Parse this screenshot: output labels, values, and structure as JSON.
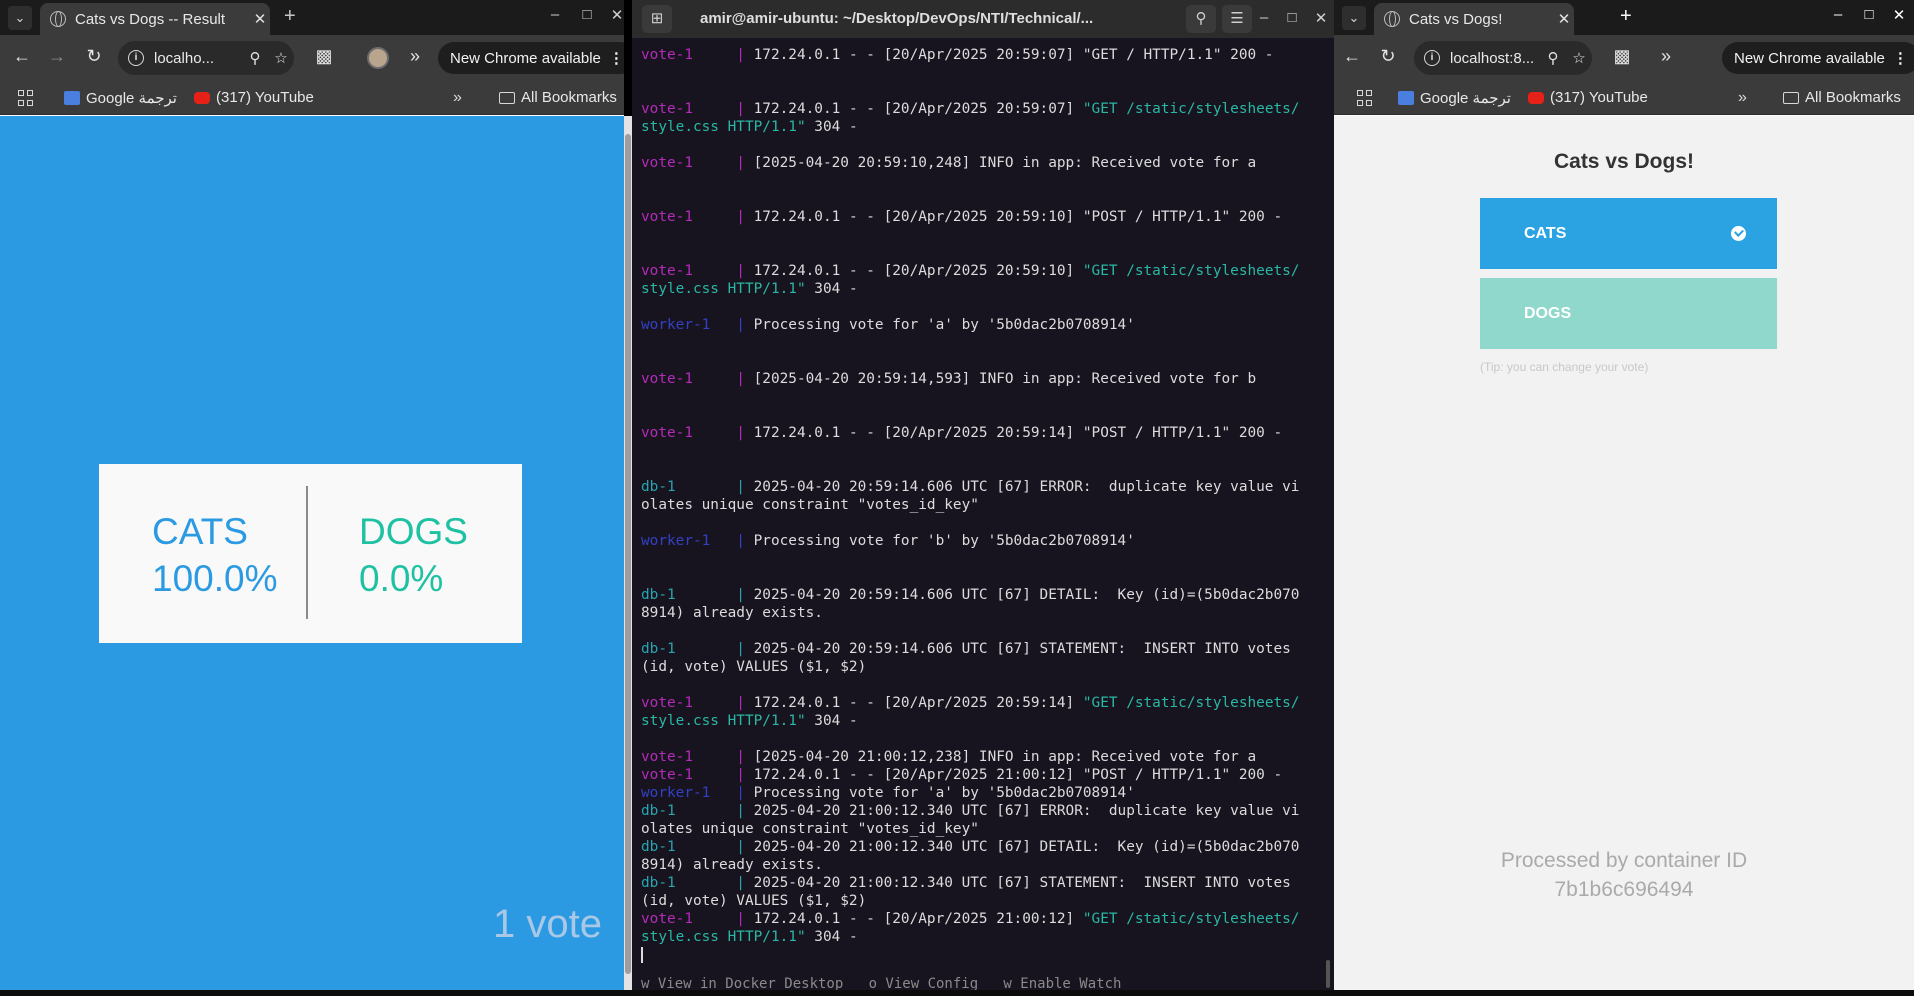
{
  "left_window": {
    "tab_title": "Cats vs Dogs -- Result",
    "url": "localho...",
    "new_chrome": "New Chrome available",
    "bookmarks": [
      "Google ترجمة",
      "(317) YouTube"
    ],
    "all_bookmarks": "All Bookmarks"
  },
  "result": {
    "cats_label": "CATS",
    "cats_pct": "100.0%",
    "dogs_label": "DOGS",
    "dogs_pct": "0.0%",
    "votes": "1 vote",
    "colors": {
      "background": "#2b9ae3",
      "cats": "#2b9ae3",
      "dogs": "#1ec1a2"
    }
  },
  "terminal": {
    "title": "amir@amir-ubuntu: ~/Desktop/DevOps/NTI/Technical/...",
    "lines": [
      {
        "svc": "vote-1",
        "type": "vote",
        "text": "172.24.0.1 - - [20/Apr/2025 20:59:07] \"GET / HTTP/1.1\" 200 -"
      },
      {
        "svc": "",
        "type": "",
        "text": ""
      },
      {
        "svc": "",
        "type": "",
        "text": ""
      },
      {
        "svc": "vote-1",
        "type": "vote",
        "text": "172.24.0.1 - - [20/Apr/2025 20:59:07] ",
        "path": "\"GET /static/stylesheets/"
      },
      {
        "svc": "",
        "type": "",
        "text": "",
        "path": "style.css HTTP/1.1\"",
        "tail": " 304 -"
      },
      {
        "svc": "",
        "type": "",
        "text": ""
      },
      {
        "svc": "vote-1",
        "type": "vote",
        "text": "[2025-04-20 20:59:10,248] INFO in app: Received vote for a"
      },
      {
        "svc": "",
        "type": "",
        "text": ""
      },
      {
        "svc": "",
        "type": "",
        "text": ""
      },
      {
        "svc": "vote-1",
        "type": "vote",
        "text": "172.24.0.1 - - [20/Apr/2025 20:59:10] \"POST / HTTP/1.1\" 200 -"
      },
      {
        "svc": "",
        "type": "",
        "text": ""
      },
      {
        "svc": "",
        "type": "",
        "text": ""
      },
      {
        "svc": "vote-1",
        "type": "vote",
        "text": "172.24.0.1 - - [20/Apr/2025 20:59:10] ",
        "path": "\"GET /static/stylesheets/"
      },
      {
        "svc": "",
        "type": "",
        "text": "",
        "path": "style.css HTTP/1.1\"",
        "tail": " 304 -"
      },
      {
        "svc": "",
        "type": "",
        "text": ""
      },
      {
        "svc": "worker-1",
        "type": "worker",
        "text": "Processing vote for 'a' by '5b0dac2b0708914'"
      },
      {
        "svc": "",
        "type": "",
        "text": ""
      },
      {
        "svc": "",
        "type": "",
        "text": ""
      },
      {
        "svc": "vote-1",
        "type": "vote",
        "text": "[2025-04-20 20:59:14,593] INFO in app: Received vote for b"
      },
      {
        "svc": "",
        "type": "",
        "text": ""
      },
      {
        "svc": "",
        "type": "",
        "text": ""
      },
      {
        "svc": "vote-1",
        "type": "vote",
        "text": "172.24.0.1 - - [20/Apr/2025 20:59:14] \"POST / HTTP/1.1\" 200 -"
      },
      {
        "svc": "",
        "type": "",
        "text": ""
      },
      {
        "svc": "",
        "type": "",
        "text": ""
      },
      {
        "svc": "db-1",
        "type": "db",
        "text": "2025-04-20 20:59:14.606 UTC [67] ERROR:  duplicate key value vi"
      },
      {
        "svc": "",
        "type": "",
        "text": "olates unique constraint \"votes_id_key\""
      },
      {
        "svc": "",
        "type": "",
        "text": ""
      },
      {
        "svc": "worker-1",
        "type": "worker",
        "text": "Processing vote for 'b' by '5b0dac2b0708914'"
      },
      {
        "svc": "",
        "type": "",
        "text": ""
      },
      {
        "svc": "",
        "type": "",
        "text": ""
      },
      {
        "svc": "db-1",
        "type": "db",
        "text": "2025-04-20 20:59:14.606 UTC [67] DETAIL:  Key (id)=(5b0dac2b070"
      },
      {
        "svc": "",
        "type": "",
        "text": "8914) already exists."
      },
      {
        "svc": "",
        "type": "",
        "text": ""
      },
      {
        "svc": "db-1",
        "type": "db",
        "text": "2025-04-20 20:59:14.606 UTC [67] STATEMENT:  INSERT INTO votes"
      },
      {
        "svc": "",
        "type": "",
        "text": "(id, vote) VALUES ($1, $2)"
      },
      {
        "svc": "",
        "type": "",
        "text": ""
      },
      {
        "svc": "vote-1",
        "type": "vote",
        "text": "172.24.0.1 - - [20/Apr/2025 20:59:14] ",
        "path": "\"GET /static/stylesheets/"
      },
      {
        "svc": "",
        "type": "",
        "text": "",
        "path": "style.css HTTP/1.1\"",
        "tail": " 304 -"
      },
      {
        "svc": "",
        "type": "",
        "text": ""
      },
      {
        "svc": "vote-1",
        "type": "vote",
        "text": "[2025-04-20 21:00:12,238] INFO in app: Received vote for a"
      },
      {
        "svc": "vote-1",
        "type": "vote",
        "text": "172.24.0.1 - - [20/Apr/2025 21:00:12] \"POST / HTTP/1.1\" 200 -"
      },
      {
        "svc": "worker-1",
        "type": "worker",
        "text": "Processing vote for 'a' by '5b0dac2b0708914'"
      },
      {
        "svc": "db-1",
        "type": "db",
        "text": "2025-04-20 21:00:12.340 UTC [67] ERROR:  duplicate key value vi"
      },
      {
        "svc": "",
        "type": "",
        "text": "olates unique constraint \"votes_id_key\""
      },
      {
        "svc": "db-1",
        "type": "db",
        "text": "2025-04-20 21:00:12.340 UTC [67] DETAIL:  Key (id)=(5b0dac2b070"
      },
      {
        "svc": "",
        "type": "",
        "text": "8914) already exists."
      },
      {
        "svc": "db-1",
        "type": "db",
        "text": "2025-04-20 21:00:12.340 UTC [67] STATEMENT:  INSERT INTO votes"
      },
      {
        "svc": "",
        "type": "",
        "text": "(id, vote) VALUES ($1, $2)"
      },
      {
        "svc": "vote-1",
        "type": "vote",
        "text": "172.24.0.1 - - [20/Apr/2025 21:00:12] ",
        "path": "\"GET /static/stylesheets/"
      },
      {
        "svc": "",
        "type": "",
        "text": "",
        "path": "style.css HTTP/1.1\"",
        "tail": " 304 -"
      }
    ],
    "footer": "w View in Docker Desktop   o View Config   w Enable Watch",
    "colors": {
      "vote": "#b42ab9",
      "worker": "#3340c4",
      "db": "#2aa3b0",
      "path": "#2ab7a5"
    }
  },
  "right_window": {
    "tab_title": "Cats vs Dogs!",
    "url": "localhost:8...",
    "new_chrome": "New Chrome available",
    "bookmarks": [
      "Google ترجمة",
      "(317) YouTube"
    ],
    "all_bookmarks": "All Bookmarks"
  },
  "vote": {
    "title": "Cats vs Dogs!",
    "cats_label": "CATS",
    "dogs_label": "DOGS",
    "tip": "(Tip: you can change your vote)",
    "processed_by": "Processed by container ID",
    "container_id": "7b1b6c696494",
    "selected": "CATS"
  }
}
